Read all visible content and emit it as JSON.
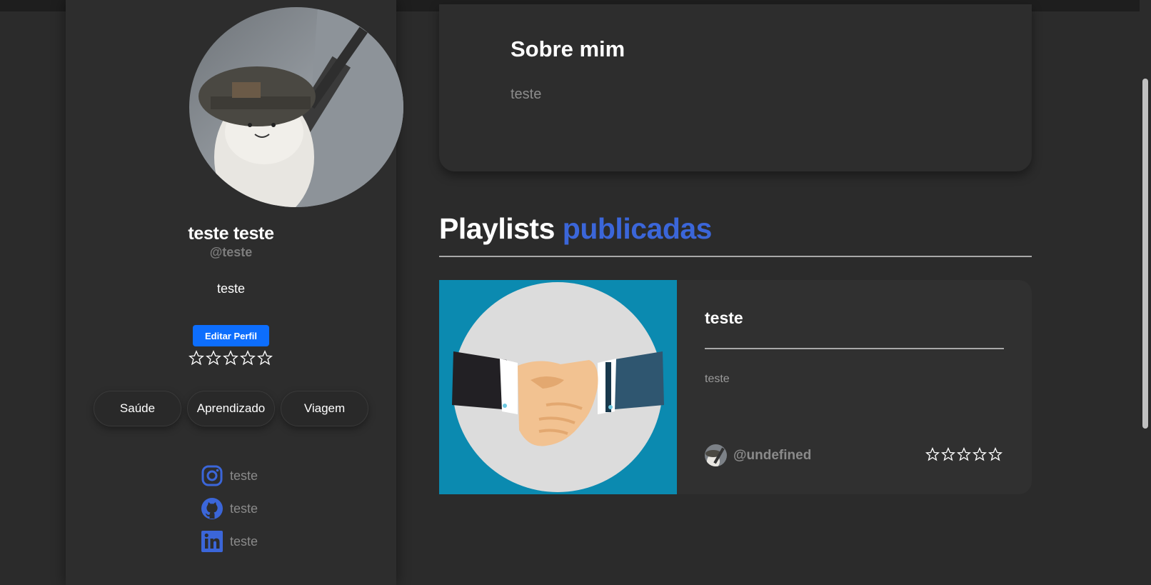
{
  "profile": {
    "name": "teste teste",
    "handle": "@teste",
    "bio": "teste",
    "edit_label": "Editar Perfil",
    "rating": 0,
    "tags": [
      "Saúde",
      "Aprendizado",
      "Viagem"
    ],
    "socials": [
      {
        "icon": "instagram-icon",
        "label": "teste"
      },
      {
        "icon": "github-icon",
        "label": "teste"
      },
      {
        "icon": "linkedin-icon",
        "label": "teste"
      }
    ]
  },
  "about": {
    "title": "Sobre mim",
    "text": "teste"
  },
  "playlists_section": {
    "title_main": "Playlists",
    "title_accent": "publicadas"
  },
  "playlists": [
    {
      "title": "teste",
      "description": "teste",
      "author": "@undefined",
      "rating": 0,
      "thumbnail_icon": "handshake-image"
    }
  ],
  "colors": {
    "background": "#2b2b2b",
    "accent": "#3b66d9",
    "button": "#0d6efd",
    "thumb_bg": "#0b8ab0"
  }
}
